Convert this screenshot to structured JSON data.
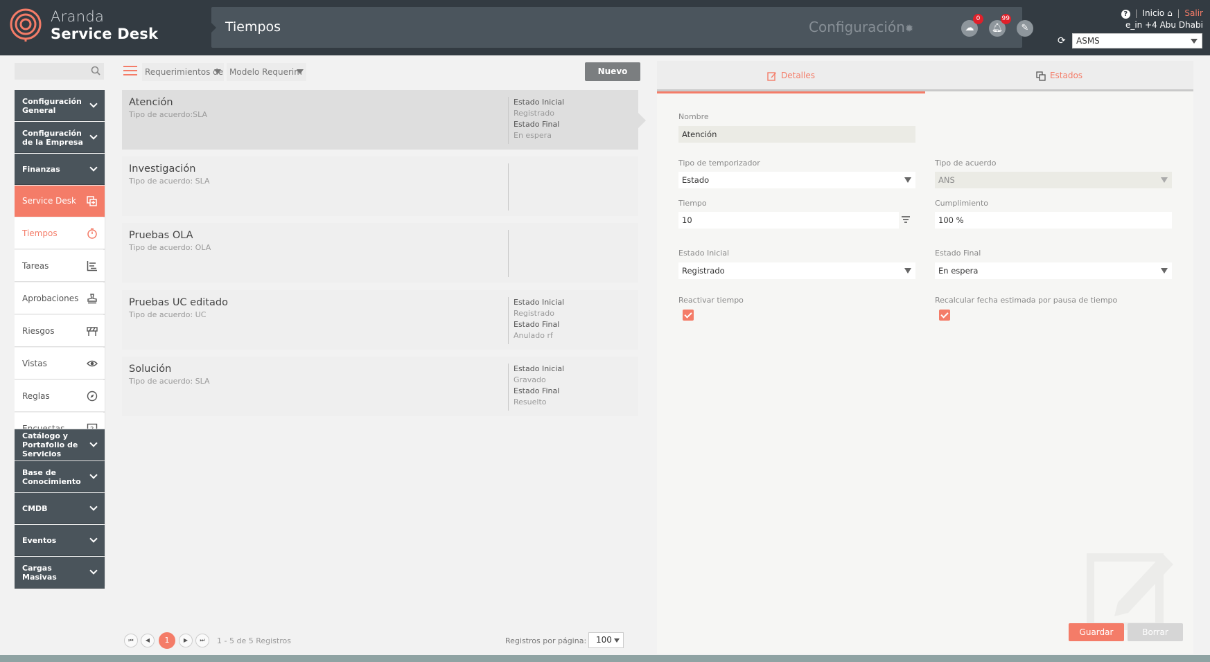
{
  "header": {
    "brand_line1": "Aranda",
    "brand_line2": "Service Desk",
    "page_title": "Tiempos",
    "config_label": "Configuración",
    "cloud_badge": "0",
    "bell_badge": "99",
    "inicio": "Inicio",
    "salir": "Salir",
    "timezone": "e_in +4 Abu Dhabi",
    "org_selected": "ASMS"
  },
  "sidebar": {
    "search_placeholder": "",
    "sections_top": [
      {
        "label_1": "Configuración",
        "label_2": "General"
      },
      {
        "label_1": "Configuración",
        "label_2": "de la Empresa"
      },
      {
        "label_1": "Finanzas",
        "label_2": ""
      }
    ],
    "service_desk": "Service Desk",
    "sub_items": [
      "Tiempos",
      "Tareas",
      "Aprobaciones",
      "Riesgos",
      "Vistas",
      "Reglas",
      "Encuestas"
    ],
    "sections_bottom": [
      {
        "label_1": "Catálogo y",
        "label_2": "Portafolio de",
        "label_3": "Servicios"
      },
      {
        "label_1": "Base de",
        "label_2": "Conocimiento",
        "label_3": ""
      },
      {
        "label_1": "CMDB",
        "label_2": "",
        "label_3": ""
      },
      {
        "label_1": "Eventos",
        "label_2": "",
        "label_3": ""
      },
      {
        "label_1": "Cargas",
        "label_2": "Masivas",
        "label_3": ""
      }
    ]
  },
  "list": {
    "filter_1": "Requerimientos de Se",
    "filter_2": "Modelo Requerim",
    "new_button": "Nuevo",
    "items": [
      {
        "name": "Atención",
        "type": "Tipo de acuerdo:SLA",
        "initial_label": "Estado Inicial",
        "initial": "Registrado",
        "final_label": "Estado Final",
        "final": "En espera"
      },
      {
        "name": "Investigación",
        "type": "Tipo de acuerdo: SLA",
        "initial_label": "",
        "initial": "",
        "final_label": "",
        "final": ""
      },
      {
        "name": "Pruebas OLA",
        "type": "Tipo de acuerdo: OLA",
        "initial_label": "",
        "initial": "",
        "final_label": "",
        "final": ""
      },
      {
        "name": "Pruebas UC editado",
        "type": "Tipo de acuerdo: UC",
        "initial_label": "Estado Inicial",
        "initial": "Registrado",
        "final_label": "Estado Final",
        "final": "Anulado rf"
      },
      {
        "name": "Solución",
        "type": "Tipo de acuerdo: SLA",
        "initial_label": "Estado Inicial",
        "initial": "Gravado",
        "final_label": "Estado Final",
        "final": "Resuelto"
      }
    ],
    "pager": {
      "first": "⏮",
      "prev": "◀",
      "current": "1",
      "next": "▶",
      "last": "⏭",
      "info": "1 - 5 de 5 Registros",
      "rpp_label": "Registros por página:",
      "rpp_value": "100"
    }
  },
  "detail": {
    "tab_details": "Detalles",
    "tab_states": "Estados",
    "nombre_label": "Nombre",
    "nombre_value": "Atención",
    "tipo_temporizador_label": "Tipo de temporizador",
    "tipo_temporizador_value": "Estado",
    "tipo_acuerdo_label": "Tipo de acuerdo",
    "tipo_acuerdo_value": "ANS",
    "tiempo_label": "Tiempo",
    "tiempo_value": "10",
    "cumplimiento_label": "Cumplimiento",
    "cumplimiento_value": "100 %",
    "estado_inicial_label": "Estado Inicial",
    "estado_inicial_value": "Registrado",
    "estado_final_label": "Estado Final",
    "estado_final_value": "En espera",
    "reactivar_label": "Reactivar tiempo",
    "recalcular_label": "Recalcular fecha estimada por pausa de tiempo",
    "reactivar_checked": true,
    "recalcular_checked": true,
    "save_button": "Guardar",
    "delete_button": "Borrar"
  },
  "colors": {
    "accent": "#f47c68",
    "header_bg": "#333b42",
    "sidebar_section": "#4a545b"
  }
}
